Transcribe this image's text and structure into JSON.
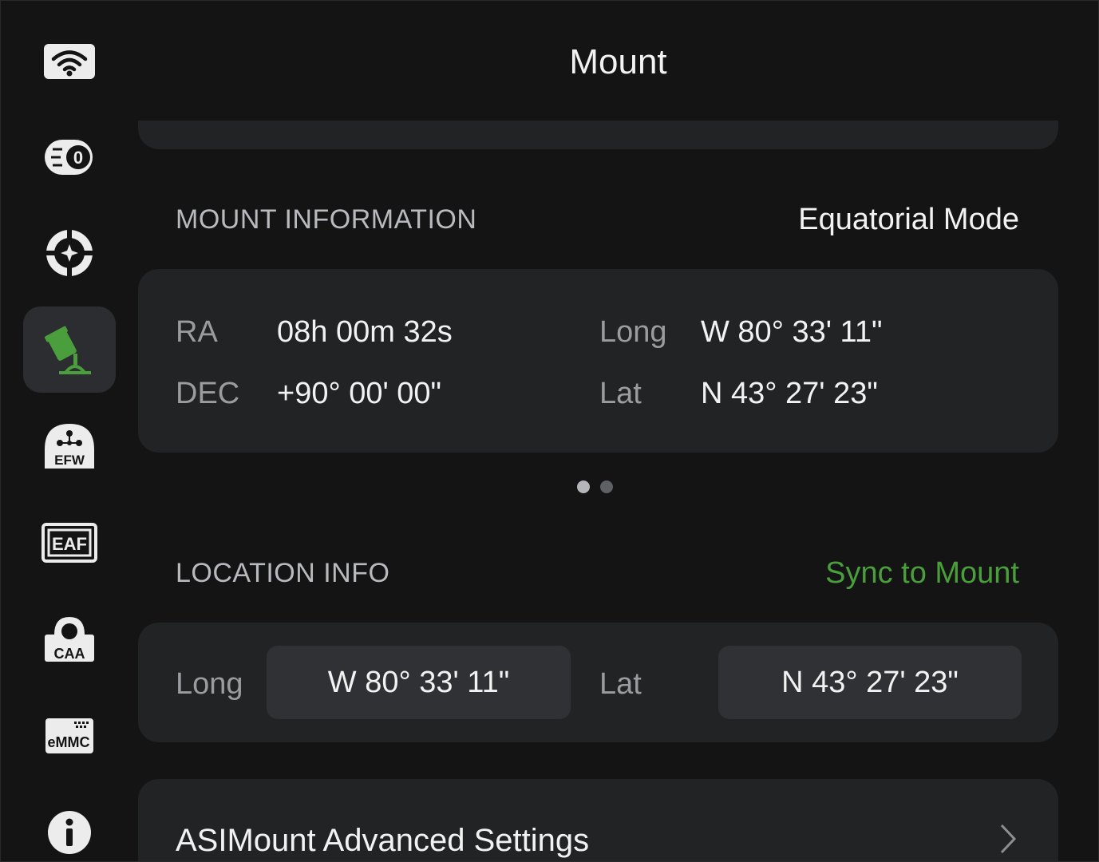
{
  "header": {
    "title": "Mount"
  },
  "sidebar": {
    "items": [
      {
        "name": "wifi",
        "icon": "wifi-icon"
      },
      {
        "name": "camera",
        "icon": "camera-icon"
      },
      {
        "name": "guide",
        "icon": "crosshair-icon"
      },
      {
        "name": "mount",
        "icon": "telescope-mount-icon",
        "active": true
      },
      {
        "name": "efw",
        "icon": "filter-wheel-icon",
        "label": "EFW"
      },
      {
        "name": "eaf",
        "icon": "focuser-icon",
        "label": "EAF"
      },
      {
        "name": "caa",
        "icon": "rotator-icon",
        "label": "CAA"
      },
      {
        "name": "emmc",
        "icon": "storage-icon",
        "label": "eMMC"
      },
      {
        "name": "info",
        "icon": "info-icon"
      }
    ]
  },
  "mount_info": {
    "label": "MOUNT INFORMATION",
    "mode": "Equatorial Mode",
    "ra_label": "RA",
    "ra_value": "08h 00m 32s",
    "dec_label": "DEC",
    "dec_value": "+90° 00' 00\"",
    "long_label": "Long",
    "long_value": "W 80° 33' 11\"",
    "lat_label": "Lat",
    "lat_value": "N 43° 27' 23\""
  },
  "pager": {
    "pages": 2,
    "current": 1
  },
  "location": {
    "label": "LOCATION INFO",
    "sync_label": "Sync to Mount",
    "long_label": "Long",
    "long_value": "W 80° 33' 11\"",
    "lat_label": "Lat",
    "lat_value": "N 43° 27' 23\""
  },
  "advanced": {
    "label": "ASIMount Advanced Settings",
    "icon": "chevron-right-icon"
  },
  "colors": {
    "accent_green": "#4a9e3c",
    "background": "#141414",
    "card": "#222325"
  }
}
